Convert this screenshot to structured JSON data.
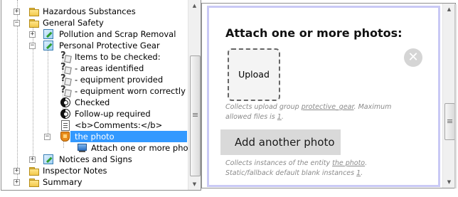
{
  "tree": {
    "items": [
      {
        "label": "Hazardous Substances",
        "icon": "folder-icon",
        "expander": "+"
      },
      {
        "label": "General Safety",
        "icon": "folder-icon",
        "expander": "−"
      },
      {
        "label": "Pollution and Scrap Removal",
        "icon": "form-icon",
        "expander": "+"
      },
      {
        "label": "Personal Protective Gear",
        "icon": "form-icon",
        "expander": "−"
      },
      {
        "label": "Items to be checked:",
        "icon": "question-icon"
      },
      {
        "label": "- areas identified",
        "icon": "question-icon"
      },
      {
        "label": "- equipment provided",
        "icon": "question-icon"
      },
      {
        "label": "- equipment worn correctly",
        "icon": "question-icon"
      },
      {
        "label": "Checked",
        "icon": "choice-icon"
      },
      {
        "label": "Follow-up required",
        "icon": "choice-icon"
      },
      {
        "label": "<b>Comments:</b>",
        "icon": "doc-icon"
      },
      {
        "label": "the photo",
        "icon": "shield-icon",
        "expander": "−",
        "selected": true
      },
      {
        "label": "Attach one or more photos:",
        "icon": "upload-icon"
      },
      {
        "label": "Notices and Signs",
        "icon": "form-icon",
        "expander": "+"
      },
      {
        "label": "Inspector Notes",
        "icon": "folder-icon",
        "expander": "+"
      },
      {
        "label": "Summary",
        "icon": "folder-icon",
        "expander": "+"
      }
    ]
  },
  "preview": {
    "title": "Attach one or more photos:",
    "upload_label": "Upload",
    "delete_icon": "close-circle-icon",
    "hint1": {
      "pre": "Collects upload group ",
      "link": "protective_gear",
      "mid": ".  Maximum allowed files is ",
      "count": "1",
      "post": "."
    },
    "add_button": "Add another photo",
    "hint2": {
      "pre": "Collects instances of the entity ",
      "link": "the photo",
      "mid": ".  Static/fallback default blank instances ",
      "count": "1",
      "post": "."
    }
  },
  "colors": {
    "selection": "#3399ff",
    "frame_border": "#c9c9f5",
    "button_bg": "#d9d9d9"
  }
}
